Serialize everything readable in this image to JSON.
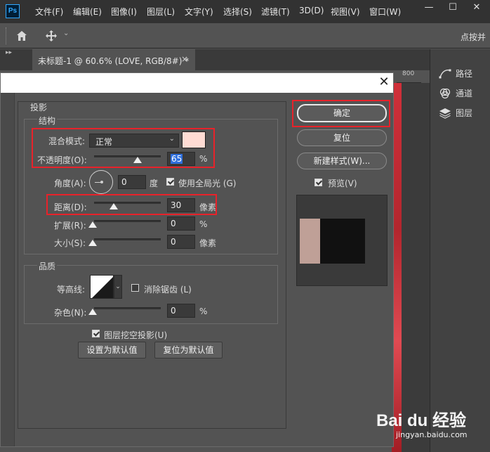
{
  "app": {
    "logo": "Ps",
    "menus": [
      "文件(F)",
      "编辑(E)",
      "图像(I)",
      "图层(L)",
      "文字(Y)",
      "选择(S)",
      "滤镜(T)",
      "3D(D)",
      "视图(V)",
      "窗口(W)"
    ],
    "window_controls": [
      "—",
      "☐",
      "✕"
    ]
  },
  "options_bar": {
    "right_text": "点按并"
  },
  "document_tab": {
    "title": "未标题-1 @ 60.6% (LOVE, RGB/8#) *",
    "close": "×"
  },
  "ruler_label": "800",
  "right_panel": {
    "items": [
      {
        "label": "路径",
        "icon": "paths-icon"
      },
      {
        "label": "通道",
        "icon": "channels-icon"
      },
      {
        "label": "图层",
        "icon": "layers-icon"
      }
    ]
  },
  "dialog": {
    "close": "✕",
    "section": "投影",
    "structure": {
      "title": "结构",
      "blend_mode_label": "混合模式:",
      "blend_mode_value": "正常",
      "shadow_color": "#ffdcd4",
      "opacity_label": "不透明度(O):",
      "opacity_value": "65",
      "opacity_unit": "%",
      "opacity_fraction": 0.65,
      "angle_label": "角度(A):",
      "angle_value": "0",
      "angle_unit": "度",
      "global_light_label": "使用全局光 (G)",
      "global_light_checked": true,
      "distance_label": "距离(D):",
      "distance_value": "30",
      "distance_unit": "像素",
      "spread_label": "扩展(R):",
      "spread_value": "0",
      "spread_unit": "%",
      "size_label": "大小(S):",
      "size_value": "0",
      "size_unit": "像素"
    },
    "quality": {
      "title": "品质",
      "contour_label": "等高线:",
      "anti_alias_label": "消除锯齿 (L)",
      "anti_alias_checked": false,
      "noise_label": "杂色(N):",
      "noise_value": "0",
      "noise_unit": "%"
    },
    "knockout_label": "图层挖空投影(U)",
    "knockout_checked": true,
    "set_default_label": "设置为默认值",
    "reset_default_label": "复位为默认值",
    "buttons": {
      "ok": "确定",
      "reset": "复位",
      "new_style": "新建样式(W)...",
      "preview_label": "预览(V)",
      "preview_checked": true
    }
  },
  "watermark": {
    "logo": "Bai du 经验",
    "url": "jingyan.baidu.com"
  },
  "colors": {
    "highlight_red": "#e8222a",
    "canvas_red": "#c62a33"
  }
}
